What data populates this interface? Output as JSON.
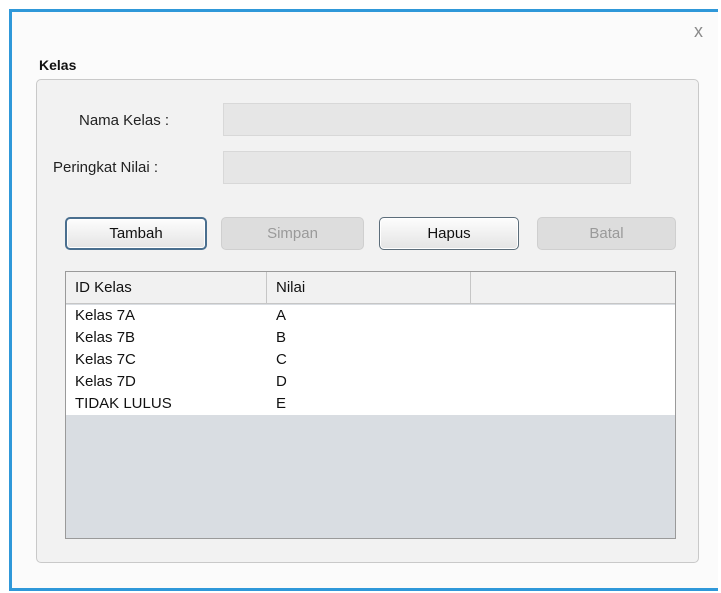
{
  "dialog": {
    "title": "Kelas",
    "close_label": "x"
  },
  "form": {
    "nama_kelas_label": "Nama Kelas :",
    "nama_kelas_value": "",
    "peringkat_label": "Peringkat Nilai :",
    "peringkat_value": ""
  },
  "buttons": {
    "tambah": "Tambah",
    "simpan": "Simpan",
    "hapus": "Hapus",
    "batal": "Batal"
  },
  "table": {
    "columns": [
      "ID Kelas",
      "Nilai",
      ""
    ],
    "rows": [
      [
        "Kelas 7A",
        "A"
      ],
      [
        "Kelas 7B",
        "B"
      ],
      [
        "Kelas 7C",
        "C"
      ],
      [
        "Kelas 7D",
        "D"
      ],
      [
        "TIDAK LULUS",
        "E"
      ]
    ]
  }
}
